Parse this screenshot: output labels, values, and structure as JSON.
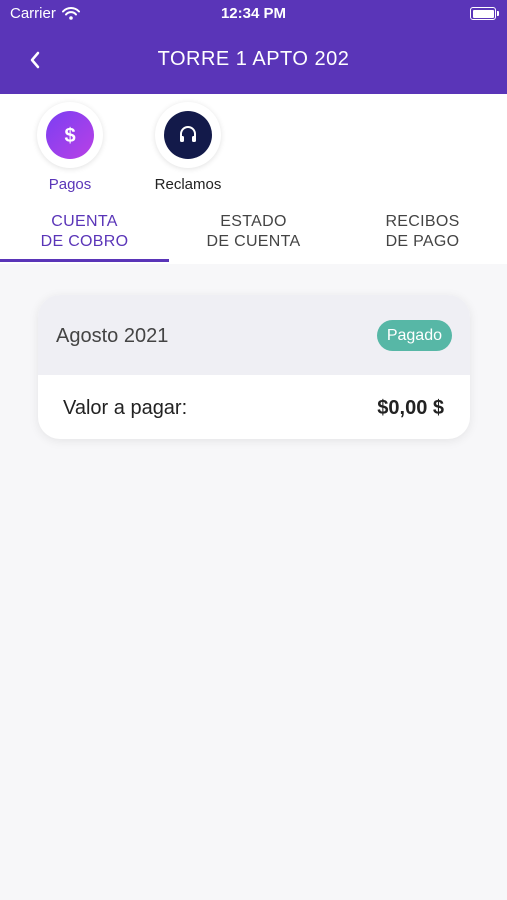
{
  "status_bar": {
    "carrier": "Carrier",
    "time": "12:34 PM"
  },
  "header": {
    "title": "TORRE 1 APTO 202"
  },
  "shortcuts": [
    {
      "label": "Pagos",
      "icon": "dollar-icon",
      "color": "#5a35b8"
    },
    {
      "label": "Reclamos",
      "icon": "headset-icon",
      "color": "#131a4a"
    }
  ],
  "tabs": [
    {
      "line1": "CUENTA",
      "line2": "DE COBRO",
      "active": true
    },
    {
      "line1": "ESTADO",
      "line2": "DE CUENTA",
      "active": false
    },
    {
      "line1": "RECIBOS",
      "line2": "DE PAGO",
      "active": false
    }
  ],
  "bill": {
    "month": "Agosto 2021",
    "status": "Pagado",
    "amount_label": "Valor a pagar:",
    "amount_value": "$0,00 $"
  },
  "colors": {
    "primary": "#5a35b8",
    "status_paid": "#57b7a6",
    "background": "#f7f7f9"
  }
}
